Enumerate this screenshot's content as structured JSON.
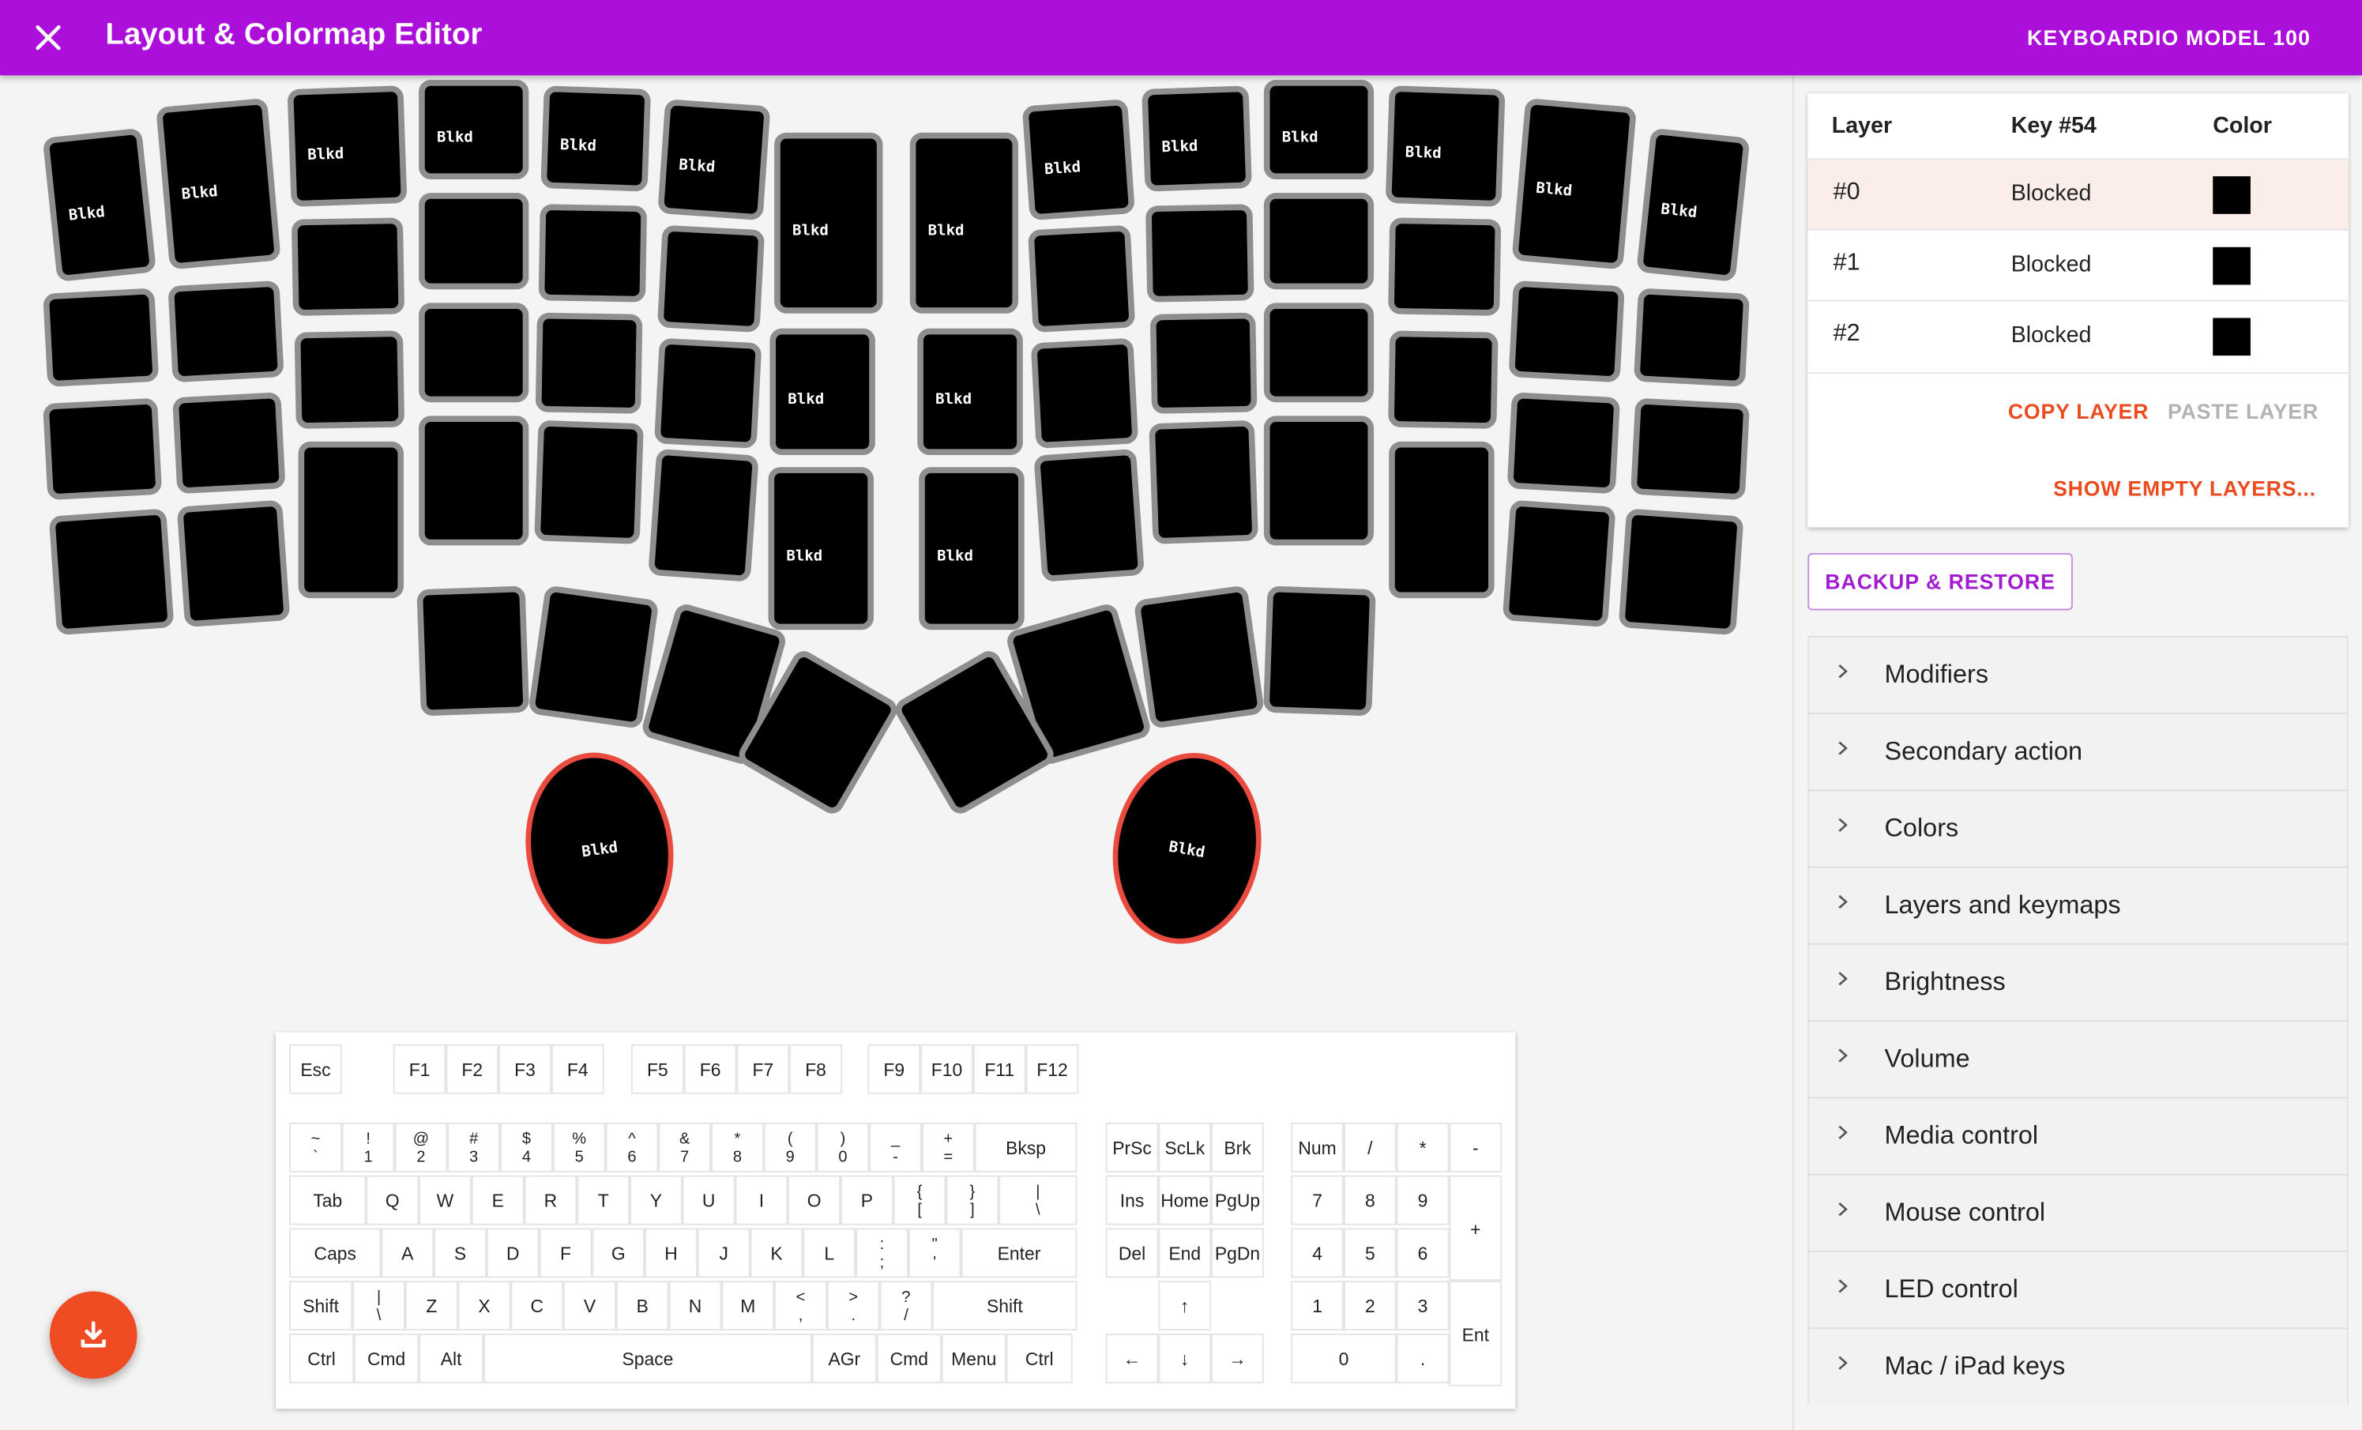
{
  "appbar": {
    "title": "Layout & Colormap Editor",
    "device": "KEYBOARDIO MODEL 100",
    "color": "#ab0fd9"
  },
  "keyboard": {
    "key_label": "Blkd",
    "key_color": "#000000",
    "palm_key_border": "#ea4b3f"
  },
  "layer_table": {
    "headers": {
      "layer": "Layer",
      "key": "Key #54",
      "color": "Color"
    },
    "rows": [
      {
        "layer": "#0",
        "value": "Blocked",
        "color": "#000000",
        "selected": true
      },
      {
        "layer": "#1",
        "value": "Blocked",
        "color": "#000000",
        "selected": false
      },
      {
        "layer": "#2",
        "value": "Blocked",
        "color": "#000000",
        "selected": false
      }
    ],
    "copy_layer": "COPY LAYER",
    "paste_layer": "PASTE LAYER",
    "show_empty": "SHOW EMPTY LAYERS..."
  },
  "backup_restore": "BACKUP & RESTORE",
  "accordion": [
    "Modifiers",
    "Secondary action",
    "Colors",
    "Layers and keymaps",
    "Brightness",
    "Volume",
    "Media control",
    "Mouse control",
    "LED control",
    "Mac / iPad keys"
  ],
  "picker": {
    "function_row": [
      "Esc",
      "F1",
      "F2",
      "F3",
      "F4",
      "F5",
      "F6",
      "F7",
      "F8",
      "F9",
      "F10",
      "F11",
      "F12"
    ],
    "number_row": [
      "~\n`",
      "!\n1",
      "@\n2",
      "#\n3",
      "$\n4",
      "%\n5",
      "^\n6",
      "&\n7",
      "*\n8",
      "(\n9",
      ")\n0",
      "_\n-",
      "+\n=",
      "Bksp"
    ],
    "top_row": [
      "Tab",
      "Q",
      "W",
      "E",
      "R",
      "T",
      "Y",
      "U",
      "I",
      "O",
      "P",
      "{\n[",
      "}\n]",
      "|\n\\"
    ],
    "home_row": [
      "Caps",
      "A",
      "S",
      "D",
      "F",
      "G",
      "H",
      "J",
      "K",
      "L",
      ":\n;",
      "\"\n'",
      "Enter"
    ],
    "bottom_row": [
      "Shift",
      "|\n\\",
      "Z",
      "X",
      "C",
      "V",
      "B",
      "N",
      "M",
      "<\n,",
      ">\n.",
      "?\n/",
      "Shift"
    ],
    "space_row": [
      "Ctrl",
      "Cmd",
      "Alt",
      "Space",
      "AGr",
      "Cmd",
      "Menu",
      "Ctrl"
    ],
    "nav": [
      "PrSc",
      "ScLk",
      "Brk",
      "Ins",
      "Home",
      "PgUp",
      "Del",
      "End",
      "PgDn"
    ],
    "arrows": [
      "↑",
      "←",
      "↓",
      "→"
    ],
    "numpad": [
      "Num",
      "/",
      "*",
      "-",
      "7",
      "8",
      "9",
      "+",
      "4",
      "5",
      "6",
      "1",
      "2",
      "3",
      "Ent",
      "0",
      "."
    ]
  },
  "fab": {
    "icon": "download-icon",
    "color": "#ef4c24"
  }
}
